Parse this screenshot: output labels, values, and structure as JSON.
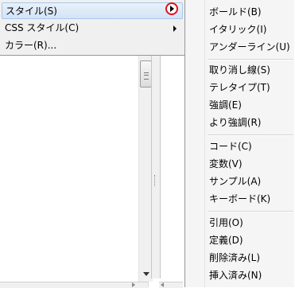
{
  "menu": {
    "items": [
      {
        "label": "スタイル(S)",
        "has_submenu": true,
        "highlighted": true
      },
      {
        "label": "CSS スタイル(C)",
        "has_submenu": true,
        "highlighted": false
      },
      {
        "label": "カラー(R)...",
        "has_submenu": false,
        "highlighted": false
      }
    ]
  },
  "submenu": {
    "groups": [
      [
        "ボールド(B)",
        "イタリック(I)",
        "アンダーライン(U)"
      ],
      [
        "取り消し線(S)",
        "テレタイプ(T)",
        "強調(E)",
        "より強調(R)"
      ],
      [
        "コード(C)",
        "変数(V)",
        "サンプル(A)",
        "キーボード(K)"
      ],
      [
        "引用(O)",
        "定義(D)",
        "削除済み(L)",
        "挿入済み(N)"
      ]
    ]
  },
  "colors": {
    "highlight_marker": "#e2101a",
    "menu_background": "#f0f0f0",
    "highlight_background": "#d3e3f6"
  },
  "icons": {
    "submenu_arrow": "chevron-right-icon",
    "highlight_marker": "red-circle-arrow-icon"
  }
}
